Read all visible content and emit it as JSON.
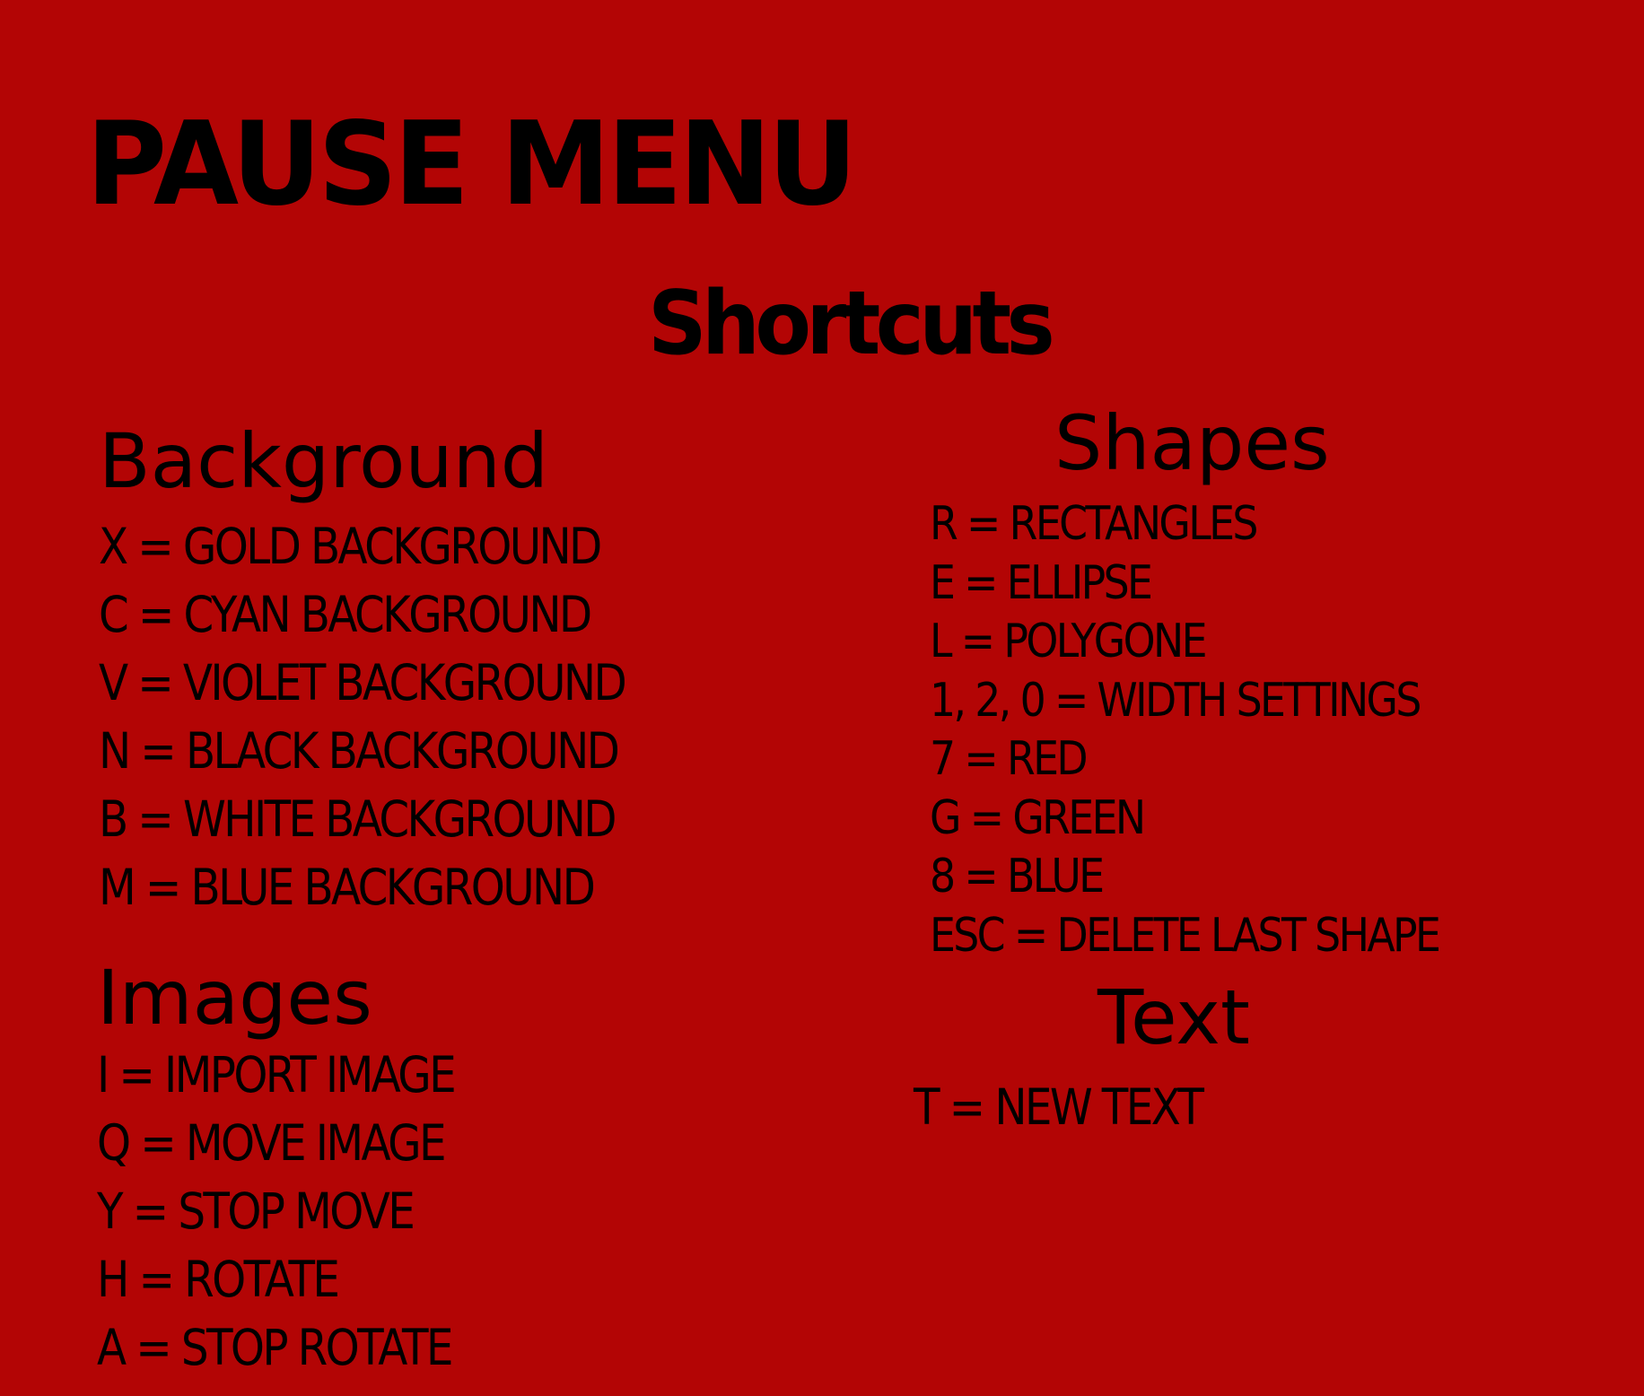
{
  "title": "PAUSE MENU",
  "subtitle": "Shortcuts",
  "colors": {
    "background": "#b30505",
    "text": "#000000"
  },
  "sections": {
    "background": {
      "heading": "Background",
      "items": [
        "X = GOLD BACKGROUND",
        "C = CYAN BACKGROUND",
        "V = VIOLET BACKGROUND",
        "N = BLACK BACKGROUND",
        "B = WHITE BACKGROUND",
        "M = BLUE BACKGROUND"
      ]
    },
    "images": {
      "heading": "Images",
      "items": [
        "I = IMPORT IMAGE",
        "Q = MOVE IMAGE",
        "Y = STOP MOVE",
        "H = ROTATE",
        "A = STOP ROTATE"
      ]
    },
    "shapes": {
      "heading": "Shapes",
      "items": [
        "R = RECTANGLES",
        "E = ELLIPSE",
        "L = POLYGONE",
        "1, 2, 0 = WIDTH SETTINGS",
        "7 = RED",
        "G = GREEN",
        "8 = BLUE",
        "ESC = DELETE LAST SHAPE"
      ]
    },
    "text": {
      "heading": "Text",
      "items": [
        "T = NEW TEXT"
      ]
    }
  }
}
